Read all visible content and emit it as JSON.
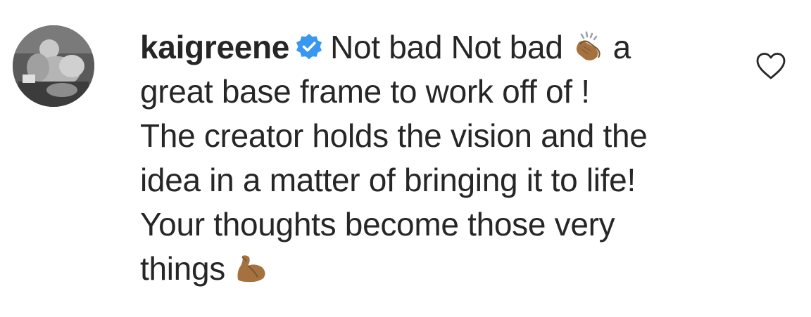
{
  "comment": {
    "username": "kaigreene",
    "verified": true,
    "line1_text": "Not bad Not bad",
    "line1_emoji": "clapping-hands-medium-dark-skin",
    "line1_tail": "a",
    "line2": "great base frame to work off of !",
    "line3": "The creator holds the vision and the",
    "line4": "idea in a matter of bringing it to life!",
    "line5": "Your thoughts become those very",
    "line6_text": "things",
    "line6_emoji": "flexed-biceps-medium-dark-skin"
  },
  "colors": {
    "text": "#262626",
    "verified_badge": "#3897f0",
    "heart_outline": "#262626",
    "emoji_skin": "#a5723f"
  },
  "icons": [
    "avatar",
    "verified-badge-icon",
    "clapping-hands-emoji",
    "flexed-biceps-emoji",
    "heart-icon"
  ]
}
